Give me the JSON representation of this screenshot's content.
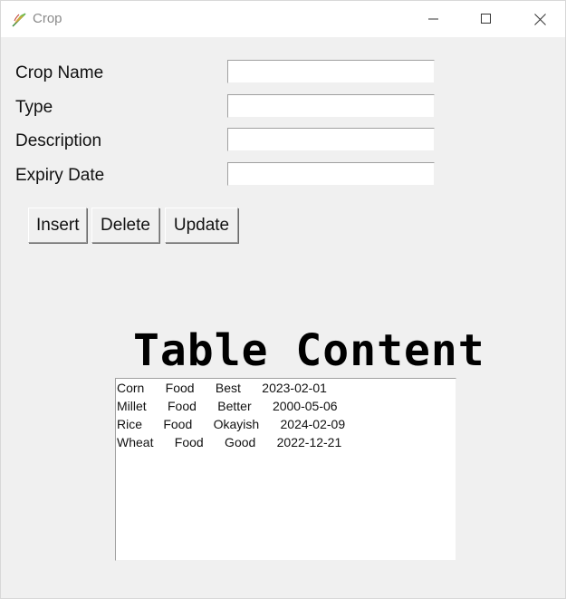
{
  "window": {
    "title": "Crop",
    "controls": [
      "minimize",
      "maximize",
      "close"
    ]
  },
  "form": {
    "crop_name_label": "Crop Name",
    "type_label": "Type",
    "description_label": "Description",
    "expiry_date_label": "Expiry Date",
    "crop_name_value": "",
    "type_value": "",
    "description_value": "",
    "expiry_date_value": ""
  },
  "buttons": {
    "insert": "Insert",
    "delete": "Delete",
    "update": "Update"
  },
  "table": {
    "heading": "Table Content",
    "rows": [
      "Corn      Food      Best      2023-02-01",
      "Millet      Food      Better      2000-05-06",
      "Rice      Food      Okayish      2024-02-09",
      "Wheat      Food      Good      2022-12-21"
    ]
  }
}
